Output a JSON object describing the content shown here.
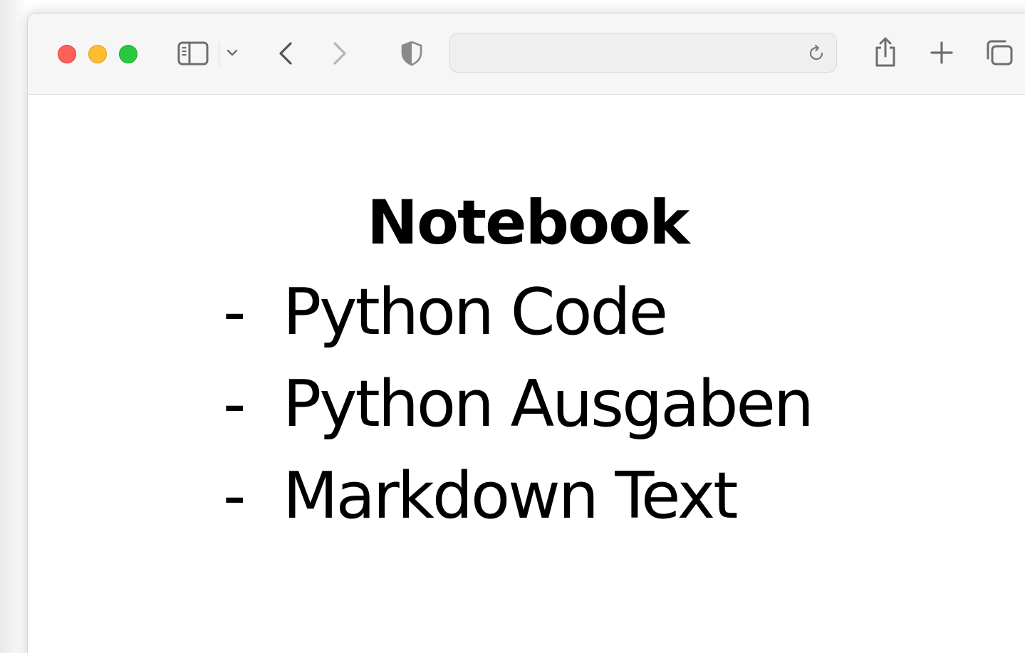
{
  "browser": {
    "address": {
      "value": "",
      "placeholder": ""
    },
    "icons": {
      "close": "red-traffic-light",
      "minimize": "yellow-traffic-light",
      "zoom": "green-traffic-light",
      "sidebar": "sidebar-icon",
      "sidebar_menu": "chevron-down-icon",
      "back": "chevron-left-icon",
      "forward": "chevron-right-icon",
      "privacy": "shield-icon",
      "reload": "reload-icon",
      "share": "share-icon",
      "new_tab": "plus-icon",
      "tab_overview": "tabs-icon"
    },
    "colors": {
      "close": "#fe5f57",
      "minimize": "#febc2e",
      "zoom": "#28c840",
      "toolbar_bg": "#f6f6f6",
      "icon": "#6e6e6e"
    }
  },
  "page": {
    "title": "Notebook",
    "items": [
      {
        "dash": "-",
        "text": "Python Code"
      },
      {
        "dash": "-",
        "text": "Python Ausgaben"
      },
      {
        "dash": "-",
        "text": "Markdown Text"
      }
    ]
  }
}
